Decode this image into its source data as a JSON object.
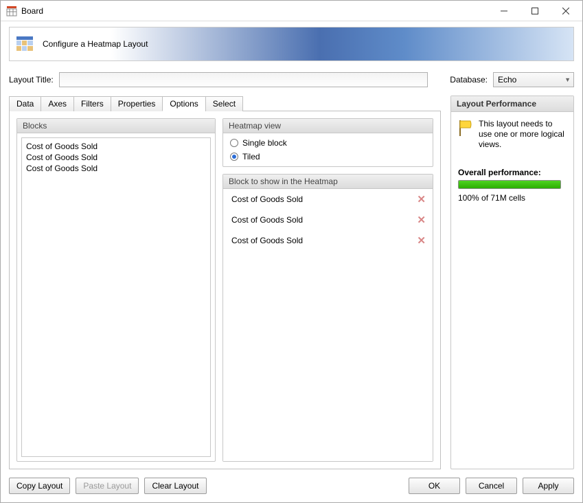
{
  "window": {
    "title": "Board"
  },
  "banner": {
    "text": "Configure a Heatmap Layout"
  },
  "layoutTitle": {
    "label": "Layout Title:",
    "value": ""
  },
  "database": {
    "label": "Database:",
    "value": "Echo"
  },
  "tabs": [
    {
      "label": "Data"
    },
    {
      "label": "Axes"
    },
    {
      "label": "Filters"
    },
    {
      "label": "Properties"
    },
    {
      "label": "Options"
    },
    {
      "label": "Select"
    }
  ],
  "blocks": {
    "title": "Blocks",
    "items": [
      {
        "label": "Cost of Goods Sold"
      },
      {
        "label": "Cost of Goods Sold"
      },
      {
        "label": "Cost of Goods Sold"
      }
    ]
  },
  "heatmapView": {
    "title": "Heatmap view",
    "options": {
      "single": "Single block",
      "tiled": "Tiled"
    },
    "selected": "tiled"
  },
  "heatmapBlocks": {
    "title": "Block to show in the Heatmap",
    "items": [
      {
        "label": "Cost of Goods Sold"
      },
      {
        "label": "Cost of Goods Sold"
      },
      {
        "label": "Cost of Goods Sold"
      }
    ]
  },
  "performance": {
    "title": "Layout Performance",
    "note": "This layout needs to use one or more logical views.",
    "overallLabel": "Overall performance:",
    "percent": 100,
    "cellsText": "100% of 71M cells"
  },
  "footer": {
    "copy": "Copy Layout",
    "paste": "Paste Layout",
    "clear": "Clear Layout",
    "ok": "OK",
    "cancel": "Cancel",
    "apply": "Apply"
  }
}
